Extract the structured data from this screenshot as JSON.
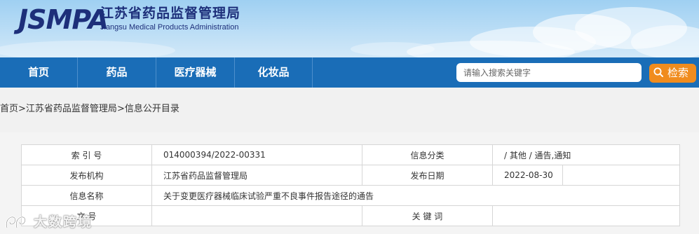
{
  "header": {
    "logo": "JSMPA",
    "org_name_cn": "江苏省药品监督管理局",
    "org_name_en": "Jiangsu Medical Products Administration"
  },
  "nav": {
    "items": [
      "首页",
      "药品",
      "医疗器械",
      "化妆品"
    ]
  },
  "search": {
    "placeholder": "请输入搜索关键字",
    "button_label": "检索",
    "button_color": "#f08c1e"
  },
  "breadcrumb": {
    "items": [
      "首页",
      "江苏省药品监督管理局",
      "信息公开目录"
    ],
    "separator": ">"
  },
  "info_table": {
    "index_label": "索 引 号",
    "index_value": "014000394/2022-00331",
    "category_label": "信息分类",
    "category_value": "/ 其他 / 通告,通知",
    "publisher_label": "发布机构",
    "publisher_value": "江苏省药品监督管理局",
    "date_label": "发布日期",
    "date_value": "2022-08-30",
    "name_label": "信息名称",
    "name_value": "关于变更医疗器械临床试验严重不良事件报告途径的通告",
    "doc_no_label": "文 号",
    "doc_no_value": "",
    "keywords_label": "关 键 词",
    "keywords_value": ""
  },
  "watermark": {
    "text": "大数跨境"
  },
  "colors": {
    "nav_bg": "#1a6db7",
    "brand_text": "#1d2f7a",
    "band_bg": "#f1f1f1"
  }
}
